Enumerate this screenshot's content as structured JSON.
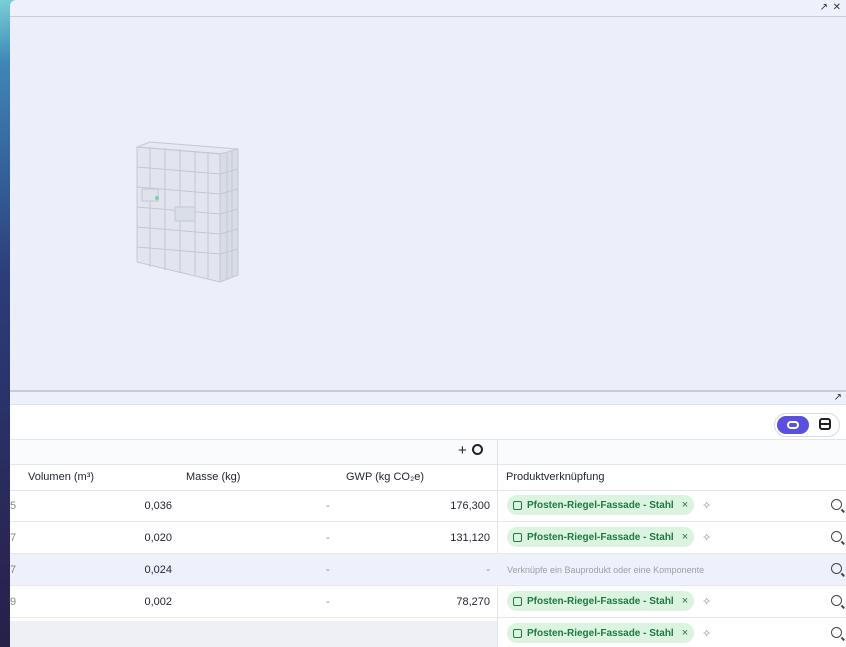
{
  "window": {
    "expand_icon": "↗",
    "close_icon": "✕",
    "expand2_icon": "↗"
  },
  "toolbar": {
    "add": "+"
  },
  "table": {
    "headers": {
      "volumen": "Volumen (m³)",
      "masse": "Masse (kg)",
      "gwp": "GWP (kg CO₂e)",
      "produkt": "Produktverknüpfung"
    },
    "rows": [
      {
        "idx": "5",
        "volumen": "0,036",
        "masse": "-",
        "gwp": "176,300",
        "produkt": "Pfosten-Riegel-Fassade - Stahl",
        "remove": "×",
        "hint": ""
      },
      {
        "idx": "7",
        "volumen": "0,020",
        "masse": "-",
        "gwp": "131,120",
        "produkt": "Pfosten-Riegel-Fassade - Stahl",
        "remove": "×",
        "hint": ""
      },
      {
        "idx": "7",
        "volumen": "0,024",
        "masse": "-",
        "gwp": "-",
        "produkt": "",
        "remove": "",
        "hint": "Verknüpfe ein Bauprodukt oder eine Komponente"
      },
      {
        "idx": "9",
        "volumen": "0,002",
        "masse": "-",
        "gwp": "78,270",
        "produkt": "Pfosten-Riegel-Fassade - Stahl",
        "remove": "×",
        "hint": ""
      },
      {
        "idx": "",
        "volumen": "",
        "masse": "",
        "gwp": "",
        "produkt": "Pfosten-Riegel-Fassade - Stahl",
        "remove": "×",
        "hint": ""
      }
    ]
  },
  "colors": {
    "accent": "#5b4fe0",
    "chip_bg": "#ddf3e2",
    "chip_text": "#1c7a3c"
  }
}
